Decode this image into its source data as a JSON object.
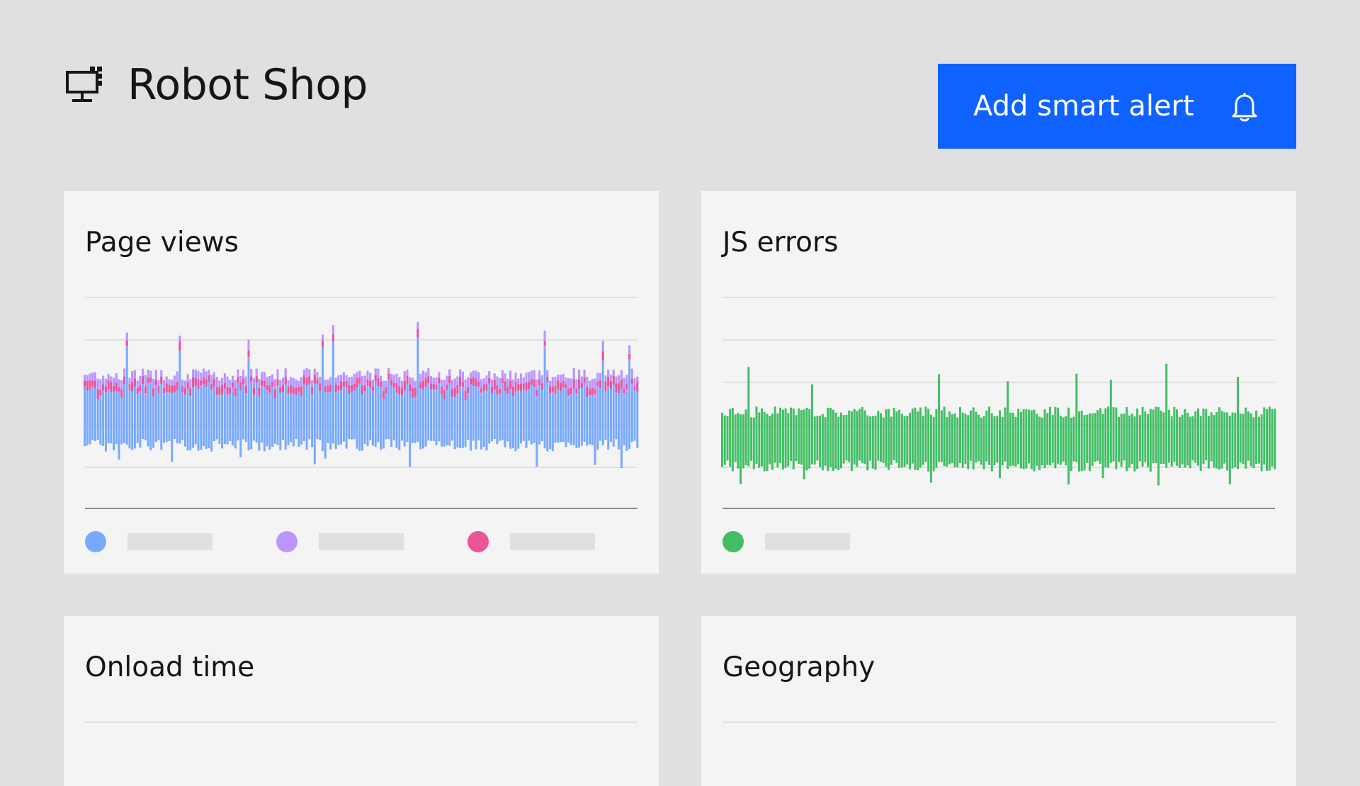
{
  "header": {
    "app_icon": "monitor-app-icon",
    "title": "Robot Shop",
    "alert_button": {
      "label": "Add smart alert",
      "icon": "bell-icon"
    }
  },
  "cards": {
    "page_views": {
      "title": "Page views",
      "series_colors": [
        "#78a9ff",
        "#be95ff",
        "#ee5396"
      ],
      "legend": [
        {
          "color": "#78a9ff"
        },
        {
          "color": "#be95ff"
        },
        {
          "color": "#ee5396"
        }
      ]
    },
    "js_errors": {
      "title": "JS errors",
      "series_colors": [
        "#42be65"
      ],
      "legend": [
        {
          "color": "#42be65"
        }
      ]
    },
    "onload_time": {
      "title": "Onload time"
    },
    "geography": {
      "title": "Geography"
    }
  },
  "colors": {
    "background": "#e0e0e0",
    "card": "#f4f4f4",
    "accent": "#0f62fe",
    "text": "#161616"
  }
}
